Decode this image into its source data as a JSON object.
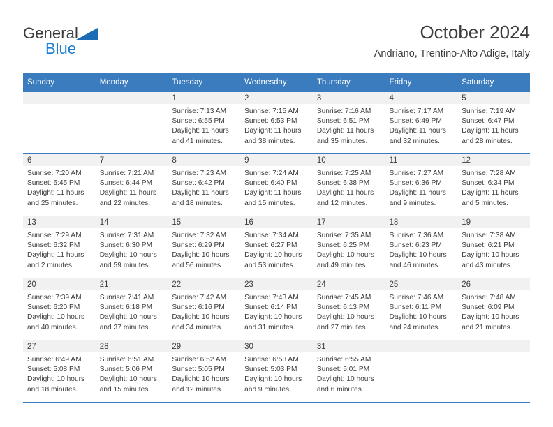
{
  "brand": {
    "name_part1": "General",
    "name_part2": "Blue",
    "triangle_icon": "brand-triangle-icon",
    "colors": {
      "blue": "#1a7fd4",
      "triangle": "#1a6cb5",
      "text": "#3b3b3b"
    }
  },
  "header": {
    "title": "October 2024",
    "subtitle": "Andriano, Trentino-Alto Adige, Italy"
  },
  "theme": {
    "header_blue": "#3a7cbe",
    "daynum_band": "#f1f1f1",
    "text": "#3c3c3c"
  },
  "calendar": {
    "weekday_headers": [
      "Sunday",
      "Monday",
      "Tuesday",
      "Wednesday",
      "Thursday",
      "Friday",
      "Saturday"
    ],
    "labels": {
      "sunrise": "Sunrise:",
      "sunset": "Sunset:",
      "daylight": "Daylight:"
    },
    "weeks": [
      [
        {
          "empty": true
        },
        {
          "empty": true
        },
        {
          "day": "1",
          "sunrise": "Sunrise: 7:13 AM",
          "sunset": "Sunset: 6:55 PM",
          "daylight_line1": "Daylight: 11 hours",
          "daylight_line2": "and 41 minutes."
        },
        {
          "day": "2",
          "sunrise": "Sunrise: 7:15 AM",
          "sunset": "Sunset: 6:53 PM",
          "daylight_line1": "Daylight: 11 hours",
          "daylight_line2": "and 38 minutes."
        },
        {
          "day": "3",
          "sunrise": "Sunrise: 7:16 AM",
          "sunset": "Sunset: 6:51 PM",
          "daylight_line1": "Daylight: 11 hours",
          "daylight_line2": "and 35 minutes."
        },
        {
          "day": "4",
          "sunrise": "Sunrise: 7:17 AM",
          "sunset": "Sunset: 6:49 PM",
          "daylight_line1": "Daylight: 11 hours",
          "daylight_line2": "and 32 minutes."
        },
        {
          "day": "5",
          "sunrise": "Sunrise: 7:19 AM",
          "sunset": "Sunset: 6:47 PM",
          "daylight_line1": "Daylight: 11 hours",
          "daylight_line2": "and 28 minutes."
        }
      ],
      [
        {
          "day": "6",
          "sunrise": "Sunrise: 7:20 AM",
          "sunset": "Sunset: 6:45 PM",
          "daylight_line1": "Daylight: 11 hours",
          "daylight_line2": "and 25 minutes."
        },
        {
          "day": "7",
          "sunrise": "Sunrise: 7:21 AM",
          "sunset": "Sunset: 6:44 PM",
          "daylight_line1": "Daylight: 11 hours",
          "daylight_line2": "and 22 minutes."
        },
        {
          "day": "8",
          "sunrise": "Sunrise: 7:23 AM",
          "sunset": "Sunset: 6:42 PM",
          "daylight_line1": "Daylight: 11 hours",
          "daylight_line2": "and 18 minutes."
        },
        {
          "day": "9",
          "sunrise": "Sunrise: 7:24 AM",
          "sunset": "Sunset: 6:40 PM",
          "daylight_line1": "Daylight: 11 hours",
          "daylight_line2": "and 15 minutes."
        },
        {
          "day": "10",
          "sunrise": "Sunrise: 7:25 AM",
          "sunset": "Sunset: 6:38 PM",
          "daylight_line1": "Daylight: 11 hours",
          "daylight_line2": "and 12 minutes."
        },
        {
          "day": "11",
          "sunrise": "Sunrise: 7:27 AM",
          "sunset": "Sunset: 6:36 PM",
          "daylight_line1": "Daylight: 11 hours",
          "daylight_line2": "and 9 minutes."
        },
        {
          "day": "12",
          "sunrise": "Sunrise: 7:28 AM",
          "sunset": "Sunset: 6:34 PM",
          "daylight_line1": "Daylight: 11 hours",
          "daylight_line2": "and 5 minutes."
        }
      ],
      [
        {
          "day": "13",
          "sunrise": "Sunrise: 7:29 AM",
          "sunset": "Sunset: 6:32 PM",
          "daylight_line1": "Daylight: 11 hours",
          "daylight_line2": "and 2 minutes."
        },
        {
          "day": "14",
          "sunrise": "Sunrise: 7:31 AM",
          "sunset": "Sunset: 6:30 PM",
          "daylight_line1": "Daylight: 10 hours",
          "daylight_line2": "and 59 minutes."
        },
        {
          "day": "15",
          "sunrise": "Sunrise: 7:32 AM",
          "sunset": "Sunset: 6:29 PM",
          "daylight_line1": "Daylight: 10 hours",
          "daylight_line2": "and 56 minutes."
        },
        {
          "day": "16",
          "sunrise": "Sunrise: 7:34 AM",
          "sunset": "Sunset: 6:27 PM",
          "daylight_line1": "Daylight: 10 hours",
          "daylight_line2": "and 53 minutes."
        },
        {
          "day": "17",
          "sunrise": "Sunrise: 7:35 AM",
          "sunset": "Sunset: 6:25 PM",
          "daylight_line1": "Daylight: 10 hours",
          "daylight_line2": "and 49 minutes."
        },
        {
          "day": "18",
          "sunrise": "Sunrise: 7:36 AM",
          "sunset": "Sunset: 6:23 PM",
          "daylight_line1": "Daylight: 10 hours",
          "daylight_line2": "and 46 minutes."
        },
        {
          "day": "19",
          "sunrise": "Sunrise: 7:38 AM",
          "sunset": "Sunset: 6:21 PM",
          "daylight_line1": "Daylight: 10 hours",
          "daylight_line2": "and 43 minutes."
        }
      ],
      [
        {
          "day": "20",
          "sunrise": "Sunrise: 7:39 AM",
          "sunset": "Sunset: 6:20 PM",
          "daylight_line1": "Daylight: 10 hours",
          "daylight_line2": "and 40 minutes."
        },
        {
          "day": "21",
          "sunrise": "Sunrise: 7:41 AM",
          "sunset": "Sunset: 6:18 PM",
          "daylight_line1": "Daylight: 10 hours",
          "daylight_line2": "and 37 minutes."
        },
        {
          "day": "22",
          "sunrise": "Sunrise: 7:42 AM",
          "sunset": "Sunset: 6:16 PM",
          "daylight_line1": "Daylight: 10 hours",
          "daylight_line2": "and 34 minutes."
        },
        {
          "day": "23",
          "sunrise": "Sunrise: 7:43 AM",
          "sunset": "Sunset: 6:14 PM",
          "daylight_line1": "Daylight: 10 hours",
          "daylight_line2": "and 31 minutes."
        },
        {
          "day": "24",
          "sunrise": "Sunrise: 7:45 AM",
          "sunset": "Sunset: 6:13 PM",
          "daylight_line1": "Daylight: 10 hours",
          "daylight_line2": "and 27 minutes."
        },
        {
          "day": "25",
          "sunrise": "Sunrise: 7:46 AM",
          "sunset": "Sunset: 6:11 PM",
          "daylight_line1": "Daylight: 10 hours",
          "daylight_line2": "and 24 minutes."
        },
        {
          "day": "26",
          "sunrise": "Sunrise: 7:48 AM",
          "sunset": "Sunset: 6:09 PM",
          "daylight_line1": "Daylight: 10 hours",
          "daylight_line2": "and 21 minutes."
        }
      ],
      [
        {
          "day": "27",
          "sunrise": "Sunrise: 6:49 AM",
          "sunset": "Sunset: 5:08 PM",
          "daylight_line1": "Daylight: 10 hours",
          "daylight_line2": "and 18 minutes."
        },
        {
          "day": "28",
          "sunrise": "Sunrise: 6:51 AM",
          "sunset": "Sunset: 5:06 PM",
          "daylight_line1": "Daylight: 10 hours",
          "daylight_line2": "and 15 minutes."
        },
        {
          "day": "29",
          "sunrise": "Sunrise: 6:52 AM",
          "sunset": "Sunset: 5:05 PM",
          "daylight_line1": "Daylight: 10 hours",
          "daylight_line2": "and 12 minutes."
        },
        {
          "day": "30",
          "sunrise": "Sunrise: 6:53 AM",
          "sunset": "Sunset: 5:03 PM",
          "daylight_line1": "Daylight: 10 hours",
          "daylight_line2": "and 9 minutes."
        },
        {
          "day": "31",
          "sunrise": "Sunrise: 6:55 AM",
          "sunset": "Sunset: 5:01 PM",
          "daylight_line1": "Daylight: 10 hours",
          "daylight_line2": "and 6 minutes."
        },
        {
          "empty": true
        },
        {
          "empty": true
        }
      ]
    ]
  }
}
